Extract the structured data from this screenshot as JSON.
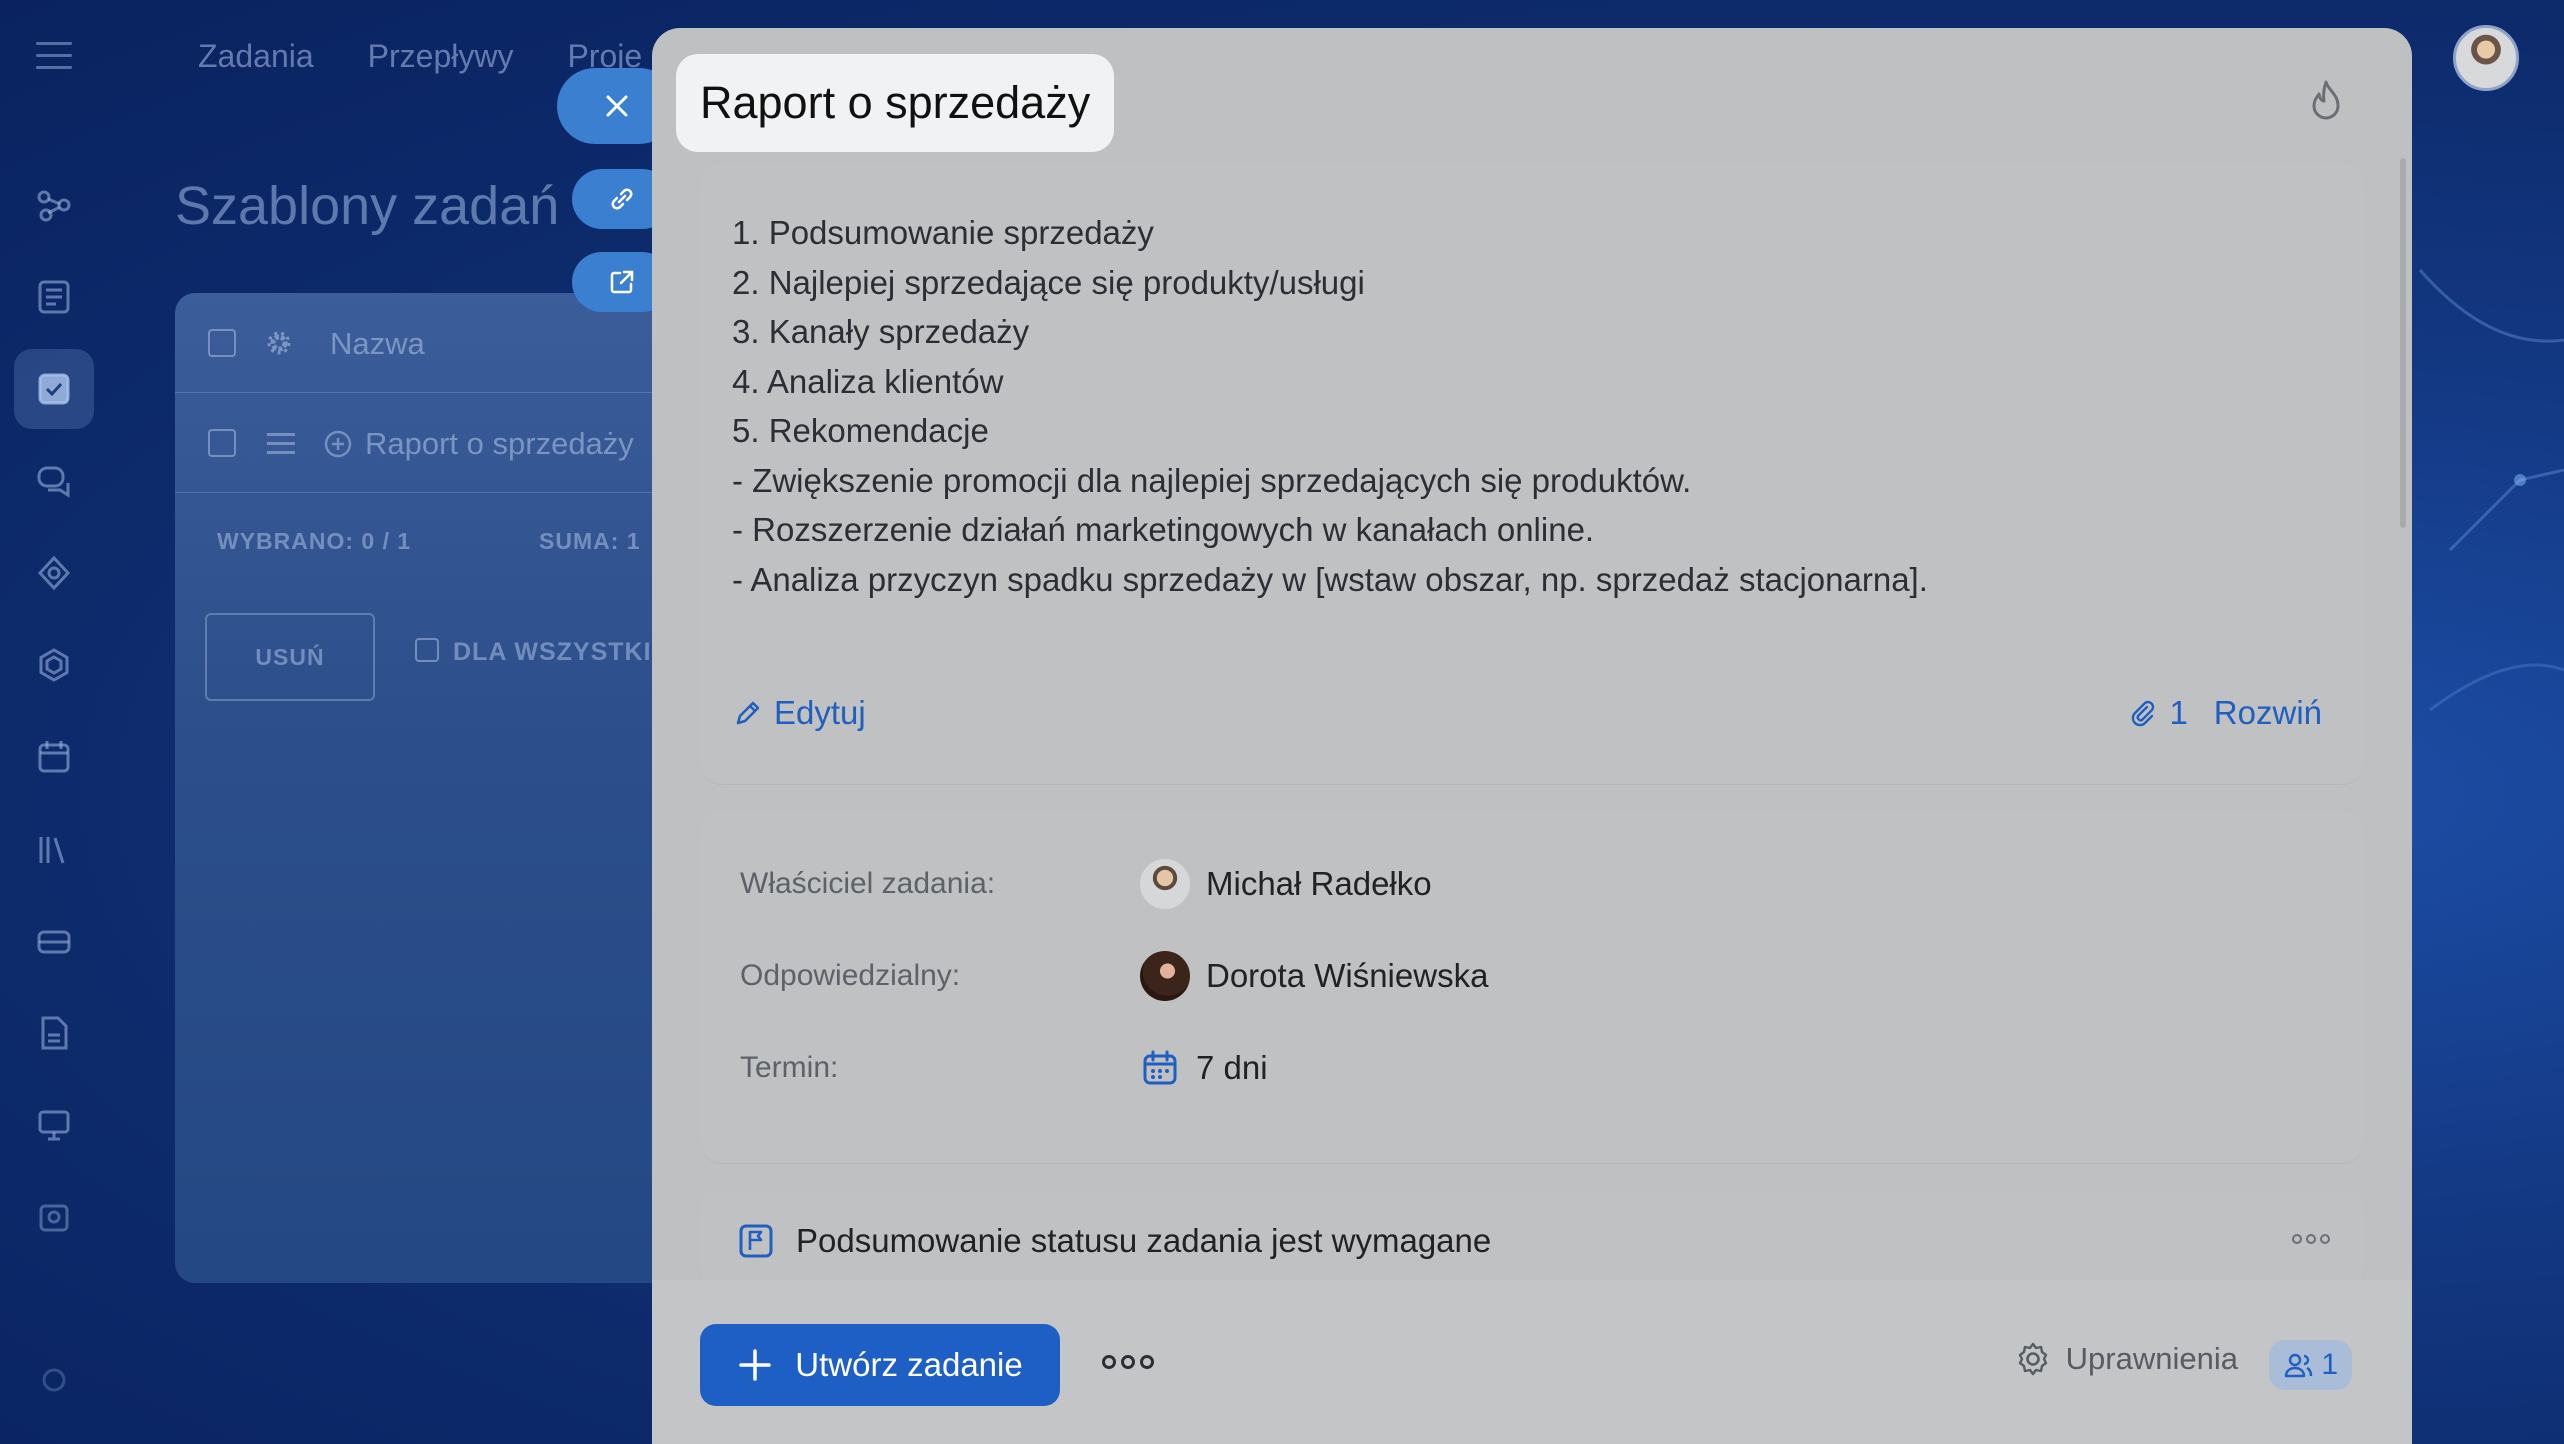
{
  "background": {
    "top_nav": [
      "Zadania",
      "Przepływy",
      "Proje"
    ],
    "page_title": "Szablony zadań",
    "table": {
      "header_label": "Nazwa",
      "row_label": "Raport o sprzedaży",
      "selected_label": "WYBRANO: 0 / 1",
      "sum_label": "SUMA: 1",
      "delete_label": "USUŃ",
      "for_all_label": "DLA WSZYSTKI"
    }
  },
  "modal": {
    "title": "Raport o sprzedaży",
    "description": [
      "1. Podsumowanie sprzedaży",
      "2. Najlepiej sprzedające się produkty/usługi",
      "3. Kanały sprzedaży",
      "4. Analiza klientów",
      "5. Rekomendacje",
      "- Zwiększenie promocji dla najlepiej sprzedających się produktów.",
      "- Rozszerzenie działań marketingowych w kanałach online.",
      "- Analiza przyczyn spadku sprzedaży w [wstaw obszar, np. sprzedaż stacjonarna]."
    ],
    "edit_label": "Edytuj",
    "attachments_count": "1",
    "expand_label": "Rozwiń",
    "fields": {
      "owner_label": "Właściciel zadania:",
      "owner_name": "Michał Radełko",
      "responsible_label": "Odpowiedzialny:",
      "responsible_name": "Dorota Wiśniewska",
      "deadline_label": "Termin:",
      "deadline_value": "7 dni"
    },
    "status_summary_label": "Podsumowanie statusu zadania jest wymagane",
    "footer": {
      "create_label": "Utwórz zadanie",
      "permissions_label": "Uprawnienia",
      "permissions_count": "1"
    }
  },
  "colors": {
    "accent": "#1d5fc4",
    "link": "#1f5fc0",
    "side_button": "#3b7fd1",
    "modal_bg": "#bfc0c2"
  }
}
